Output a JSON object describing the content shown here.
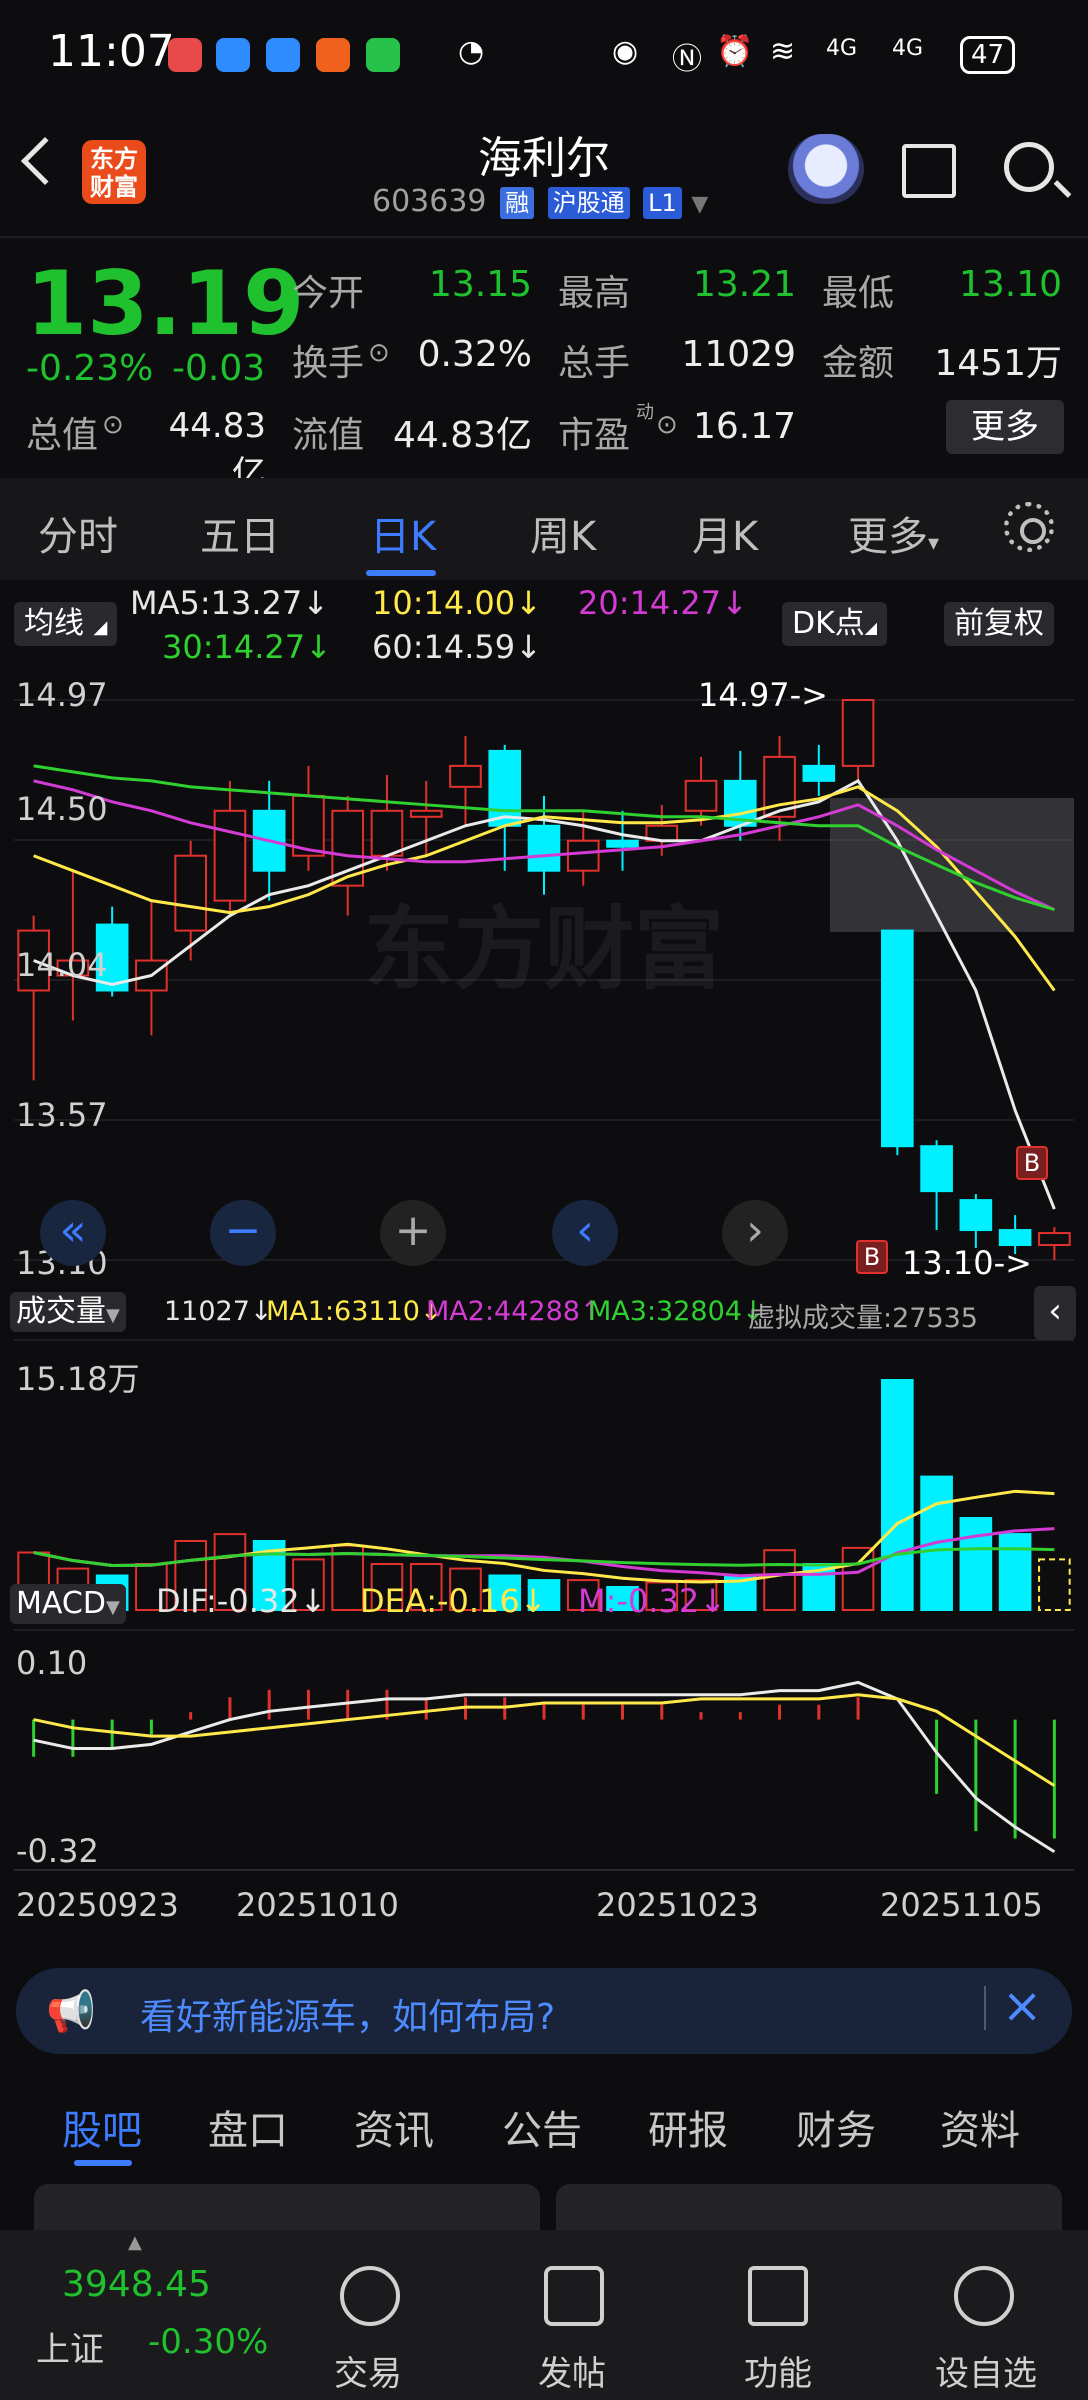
{
  "status_bar": {
    "time": "11:07",
    "network": "4G",
    "battery": "47"
  },
  "header": {
    "logo_text_line1": "东方",
    "logo_text_line2": "财富",
    "stock_name": "海利尔",
    "stock_code": "603639",
    "tags": [
      "融",
      "沪股通",
      "L1"
    ]
  },
  "quote": {
    "price": "13.19",
    "change_pct": "-0.23%",
    "change_abs": "-0.03",
    "rows": [
      [
        {
          "label": "今开",
          "value": "13.15"
        },
        {
          "label": "最高",
          "value": "13.21"
        },
        {
          "label": "最低",
          "value": "13.10"
        }
      ],
      [
        {
          "label": "换手",
          "value": "0.32%"
        },
        {
          "label": "总手",
          "value": "11029"
        },
        {
          "label": "金额",
          "value": "1451万"
        }
      ],
      [
        {
          "label": "总值",
          "value": "44.83亿"
        },
        {
          "label": "流值",
          "value": "44.83亿"
        },
        {
          "label": "市盈",
          "value": "16.17",
          "sup": "动"
        }
      ]
    ],
    "more_label": "更多"
  },
  "k_tabs": [
    "分时",
    "五日",
    "日K",
    "周K",
    "月K",
    "更多"
  ],
  "k_tab_active": "日K",
  "indicators": {
    "ma_button": "均线",
    "ma5": "MA5:13.27↓",
    "ma10": "10:14.00↓",
    "ma20": "20:14.27↓",
    "ma30": "30:14.27↓",
    "ma60": "60:14.59↓",
    "dk_button": "DK点",
    "adjust_button": "前复权"
  },
  "price_axis": [
    "14.97",
    "14.50",
    "14.04",
    "13.57",
    "13.10"
  ],
  "price_annotations": {
    "high": "14.97->",
    "low": "13.10->",
    "buy_marker": "B"
  },
  "watermark": "东方财富",
  "volume": {
    "button": "成交量",
    "current": "11027↓",
    "ma1": "MA1:63110↓",
    "ma2": "MA2:44288↑",
    "ma3": "MA3:32804↓",
    "virtual": "虚拟成交量:27535",
    "axis_top": "15.18万"
  },
  "macd": {
    "button": "MACD",
    "dif": "DIF:-0.32↓",
    "dea": "DEA:-0.16↓",
    "m": "M:-0.32↓",
    "axis_top": "0.10",
    "axis_bottom": "-0.32"
  },
  "dates": [
    "20250923",
    "20251010",
    "20251023",
    "20251105"
  ],
  "news": {
    "text": "看好新能源车，如何布局?"
  },
  "bottom_tabs": [
    "股吧",
    "盘口",
    "资讯",
    "公告",
    "研报",
    "财务",
    "资料"
  ],
  "bottom_tab_active": "股吧",
  "footer": {
    "index_value": "3948.45",
    "index_name": "上证",
    "index_change": "-0.30%",
    "items": [
      "交易",
      "发帖",
      "功能",
      "设自选"
    ]
  },
  "colors": {
    "up": "#e0312d",
    "down": "#00f0ff",
    "green": "#1fc22e",
    "accent": "#3d7bff"
  },
  "chart_data": {
    "type": "candlestick",
    "ylim": [
      13.1,
      14.97
    ],
    "candles": [
      {
        "o": 14.0,
        "c": 14.2,
        "h": 14.25,
        "l": 13.7
      },
      {
        "o": 14.05,
        "c": 14.1,
        "h": 14.4,
        "l": 13.9
      },
      {
        "o": 14.22,
        "c": 14.0,
        "h": 14.28,
        "l": 13.98
      },
      {
        "o": 14.0,
        "c": 14.1,
        "h": 14.3,
        "l": 13.85
      },
      {
        "o": 14.2,
        "c": 14.45,
        "h": 14.5,
        "l": 14.1
      },
      {
        "o": 14.3,
        "c": 14.6,
        "h": 14.7,
        "l": 14.25
      },
      {
        "o": 14.6,
        "c": 14.4,
        "h": 14.7,
        "l": 14.3
      },
      {
        "o": 14.45,
        "c": 14.65,
        "h": 14.75,
        "l": 14.4
      },
      {
        "o": 14.35,
        "c": 14.6,
        "h": 14.65,
        "l": 14.25
      },
      {
        "o": 14.45,
        "c": 14.6,
        "h": 14.72,
        "l": 14.4
      },
      {
        "o": 14.58,
        "c": 14.6,
        "h": 14.7,
        "l": 14.45
      },
      {
        "o": 14.68,
        "c": 14.75,
        "h": 14.85,
        "l": 14.55
      },
      {
        "o": 14.8,
        "c": 14.55,
        "h": 14.82,
        "l": 14.4
      },
      {
        "o": 14.55,
        "c": 14.4,
        "h": 14.65,
        "l": 14.32
      },
      {
        "o": 14.4,
        "c": 14.5,
        "h": 14.6,
        "l": 14.35
      },
      {
        "o": 14.5,
        "c": 14.48,
        "h": 14.6,
        "l": 14.4
      },
      {
        "o": 14.5,
        "c": 14.55,
        "h": 14.62,
        "l": 14.45
      },
      {
        "o": 14.6,
        "c": 14.7,
        "h": 14.78,
        "l": 14.55
      },
      {
        "o": 14.7,
        "c": 14.55,
        "h": 14.8,
        "l": 14.5
      },
      {
        "o": 14.58,
        "c": 14.78,
        "h": 14.85,
        "l": 14.5
      },
      {
        "o": 14.75,
        "c": 14.7,
        "h": 14.82,
        "l": 14.65
      },
      {
        "o": 14.75,
        "c": 14.97,
        "h": 14.97,
        "l": 14.7
      },
      {
        "o": 14.2,
        "c": 13.48,
        "h": 14.2,
        "l": 13.45
      },
      {
        "o": 13.48,
        "c": 13.33,
        "h": 13.5,
        "l": 13.2
      },
      {
        "o": 13.3,
        "c": 13.2,
        "h": 13.32,
        "l": 13.14
      },
      {
        "o": 13.2,
        "c": 13.15,
        "h": 13.25,
        "l": 13.12
      },
      {
        "o": 13.15,
        "c": 13.19,
        "h": 13.21,
        "l": 13.1
      }
    ],
    "volumes": [
      0.25,
      0.18,
      0.15,
      0.2,
      0.3,
      0.33,
      0.3,
      0.22,
      0.28,
      0.2,
      0.2,
      0.18,
      0.15,
      0.13,
      0.13,
      0.1,
      0.12,
      0.13,
      0.15,
      0.26,
      0.2,
      0.27,
      1.0,
      0.58,
      0.4,
      0.33,
      0.22
    ],
    "ma5": [
      14.1,
      14.05,
      14.02,
      14.05,
      14.15,
      14.25,
      14.32,
      14.35,
      14.4,
      14.45,
      14.5,
      14.55,
      14.58,
      14.57,
      14.55,
      14.52,
      14.5,
      14.5,
      14.55,
      14.6,
      14.63,
      14.7,
      14.5,
      14.25,
      14.0,
      13.6,
      13.27
    ],
    "ma10": [
      14.45,
      14.4,
      14.35,
      14.3,
      14.28,
      14.26,
      14.28,
      14.32,
      14.38,
      14.42,
      14.45,
      14.5,
      14.55,
      14.58,
      14.57,
      14.56,
      14.56,
      14.57,
      14.59,
      14.62,
      14.64,
      14.68,
      14.6,
      14.48,
      14.33,
      14.18,
      14.0
    ],
    "ma20": [
      14.7,
      14.67,
      14.63,
      14.6,
      14.56,
      14.53,
      14.5,
      14.47,
      14.45,
      14.44,
      14.43,
      14.43,
      14.44,
      14.45,
      14.46,
      14.47,
      14.48,
      14.5,
      14.52,
      14.55,
      14.58,
      14.62,
      14.55,
      14.47,
      14.4,
      14.33,
      14.27
    ],
    "ma30": [
      14.75,
      14.73,
      14.71,
      14.7,
      14.68,
      14.67,
      14.66,
      14.65,
      14.64,
      14.63,
      14.62,
      14.61,
      14.6,
      14.6,
      14.6,
      14.59,
      14.58,
      14.58,
      14.57,
      14.56,
      14.55,
      14.55,
      14.48,
      14.42,
      14.36,
      14.31,
      14.27
    ],
    "macd_dif": [
      -0.05,
      -0.07,
      -0.07,
      -0.06,
      -0.03,
      0.0,
      0.02,
      0.03,
      0.04,
      0.05,
      0.05,
      0.06,
      0.06,
      0.06,
      0.06,
      0.06,
      0.06,
      0.06,
      0.06,
      0.07,
      0.07,
      0.09,
      0.05,
      -0.08,
      -0.19,
      -0.26,
      -0.32
    ],
    "macd_dea": [
      0.0,
      -0.02,
      -0.03,
      -0.04,
      -0.04,
      -0.03,
      -0.02,
      -0.01,
      0.0,
      0.01,
      0.02,
      0.03,
      0.03,
      0.04,
      0.04,
      0.04,
      0.04,
      0.05,
      0.05,
      0.05,
      0.05,
      0.06,
      0.05,
      0.02,
      -0.04,
      -0.1,
      -0.16
    ]
  }
}
